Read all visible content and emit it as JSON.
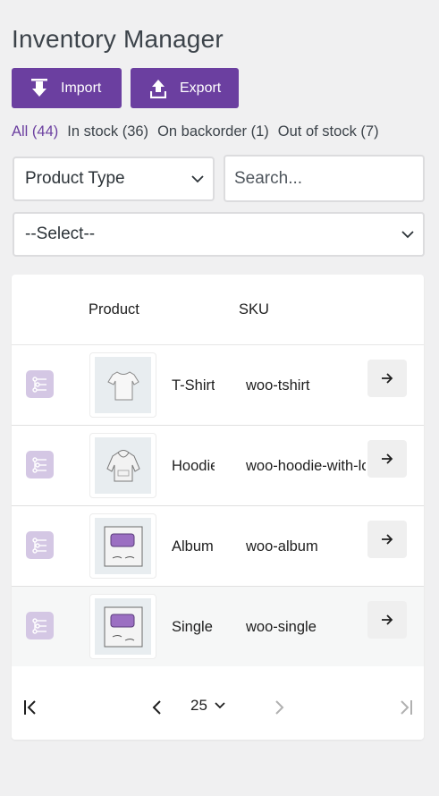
{
  "header": {
    "title": "Inventory Manager"
  },
  "toolbar": {
    "import_label": "Import",
    "export_label": "Export"
  },
  "filters": [
    {
      "label": "All (44)",
      "current": true
    },
    {
      "label": "In stock (36)",
      "current": false
    },
    {
      "label": "On backorder (1)",
      "current": false
    },
    {
      "label": "Out of stock (7)",
      "current": false
    }
  ],
  "controls": {
    "product_type_value": "Product Type",
    "search_placeholder": "Search...",
    "select_value": "--Select--"
  },
  "table": {
    "columns": {
      "product": "Product",
      "sku": "SKU"
    },
    "rows": [
      {
        "name": "T-Shirt",
        "sku": "woo-tshirt",
        "image": "tshirt"
      },
      {
        "name": "Hoodie",
        "sku": "woo-hoodie-with-logo",
        "image": "hoodie"
      },
      {
        "name": "Album",
        "sku": "woo-album",
        "image": "woo-album"
      },
      {
        "name": "Single",
        "sku": "woo-single",
        "image": "woo-single"
      }
    ]
  },
  "pagination": {
    "per_page": "25"
  },
  "colors": {
    "accent": "#6b3fa0",
    "variation_bg": "#d4c7e4",
    "background": "#f0f0f1"
  }
}
